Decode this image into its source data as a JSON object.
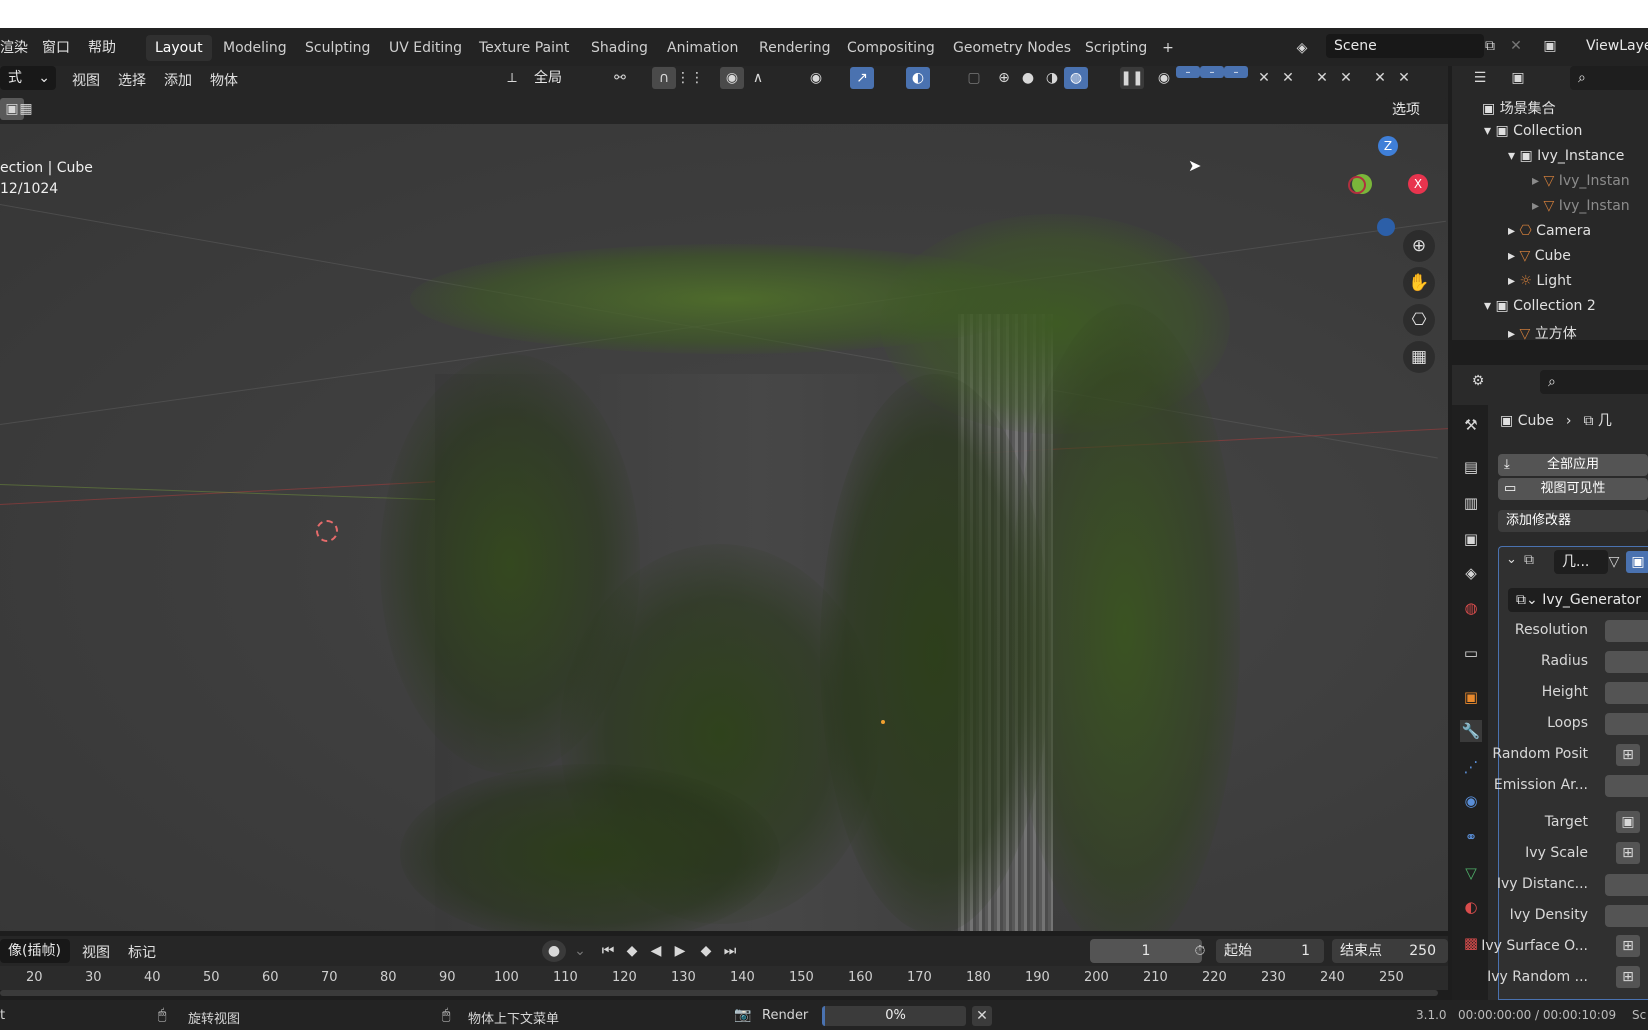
{
  "top_menu": [
    "渲染",
    "窗口",
    "帮助"
  ],
  "workspace_tabs": [
    "Layout",
    "Modeling",
    "Sculpting",
    "UV Editing",
    "Texture Paint",
    "Shading",
    "Animation",
    "Rendering",
    "Compositing",
    "Geometry Nodes",
    "Scripting"
  ],
  "active_tab": "Layout",
  "scene_name": "Scene",
  "view_layer": "ViewLayer",
  "viewport_header": {
    "mode_fragment": "式",
    "menus": [
      "视图",
      "选择",
      "添加",
      "物体"
    ],
    "transform_orientation": "全局",
    "options_label": "选项"
  },
  "viewport_overlay": {
    "line1": "ection | Cube",
    "line2": "12/1024"
  },
  "gizmo": {
    "z_label": "Z",
    "x_label": "X"
  },
  "timeline": {
    "mode_label": "像(插帧)",
    "menus": [
      "视图",
      "标记"
    ],
    "current_frame": "1",
    "start_label": "起始",
    "start_value": "1",
    "end_label": "结束点",
    "end_value": "250",
    "ruler_ticks": [
      "20",
      "30",
      "40",
      "50",
      "60",
      "70",
      "80",
      "90",
      "100",
      "110",
      "120",
      "130",
      "140",
      "150",
      "160",
      "170",
      "180",
      "190",
      "200",
      "210",
      "220",
      "230",
      "240",
      "250"
    ]
  },
  "statusbar": {
    "left_fragment": "t",
    "mouse_action_1": "旋转视图",
    "mouse_action_2": "物体上下文菜单",
    "render_label": "Render",
    "render_progress": "0%",
    "render_progress_value": 0,
    "version": "3.1.0",
    "time": "00:00:00:00 / 00:00:10:09",
    "trail": "Sc"
  },
  "outliner": {
    "root": "场景集合",
    "items": [
      {
        "label": "Collection",
        "level": 0,
        "dim": false
      },
      {
        "label": "Ivy_Instance",
        "level": 1,
        "dim": false
      },
      {
        "label": "Ivy_Instan",
        "level": 2,
        "dim": true
      },
      {
        "label": "Ivy_Instan",
        "level": 2,
        "dim": true
      },
      {
        "label": "Camera",
        "level": 1,
        "dim": false
      },
      {
        "label": "Cube",
        "level": 1,
        "dim": false
      },
      {
        "label": "Light",
        "level": 1,
        "dim": false
      },
      {
        "label": "Collection 2",
        "level": 0,
        "dim": false
      },
      {
        "label": "立方体",
        "level": 1,
        "dim": false
      }
    ]
  },
  "properties": {
    "breadcrumb_object": "Cube",
    "breadcrumb_modifier": "几",
    "apply_all": "全部应用",
    "viewport_visibility": "视图可见性",
    "add_modifier": "添加修改器",
    "modifier_name": "几...",
    "node_group": "Ivy_Generator",
    "fields": [
      "Resolution",
      "Radius",
      "Height",
      "Loops",
      "Random Posit",
      "Emission Ar...",
      "Target",
      "Ivy Scale",
      "Ivy Distanc...",
      "Ivy Density",
      "Ivy Surface O...",
      "Ivy Random ..."
    ]
  },
  "colors": {
    "accent_blue": "#4a72b0",
    "axis_x": "#e8344e",
    "axis_z": "#3f7fd8",
    "axis_y": "#7ab63a",
    "foliage": "#3e5a24"
  }
}
